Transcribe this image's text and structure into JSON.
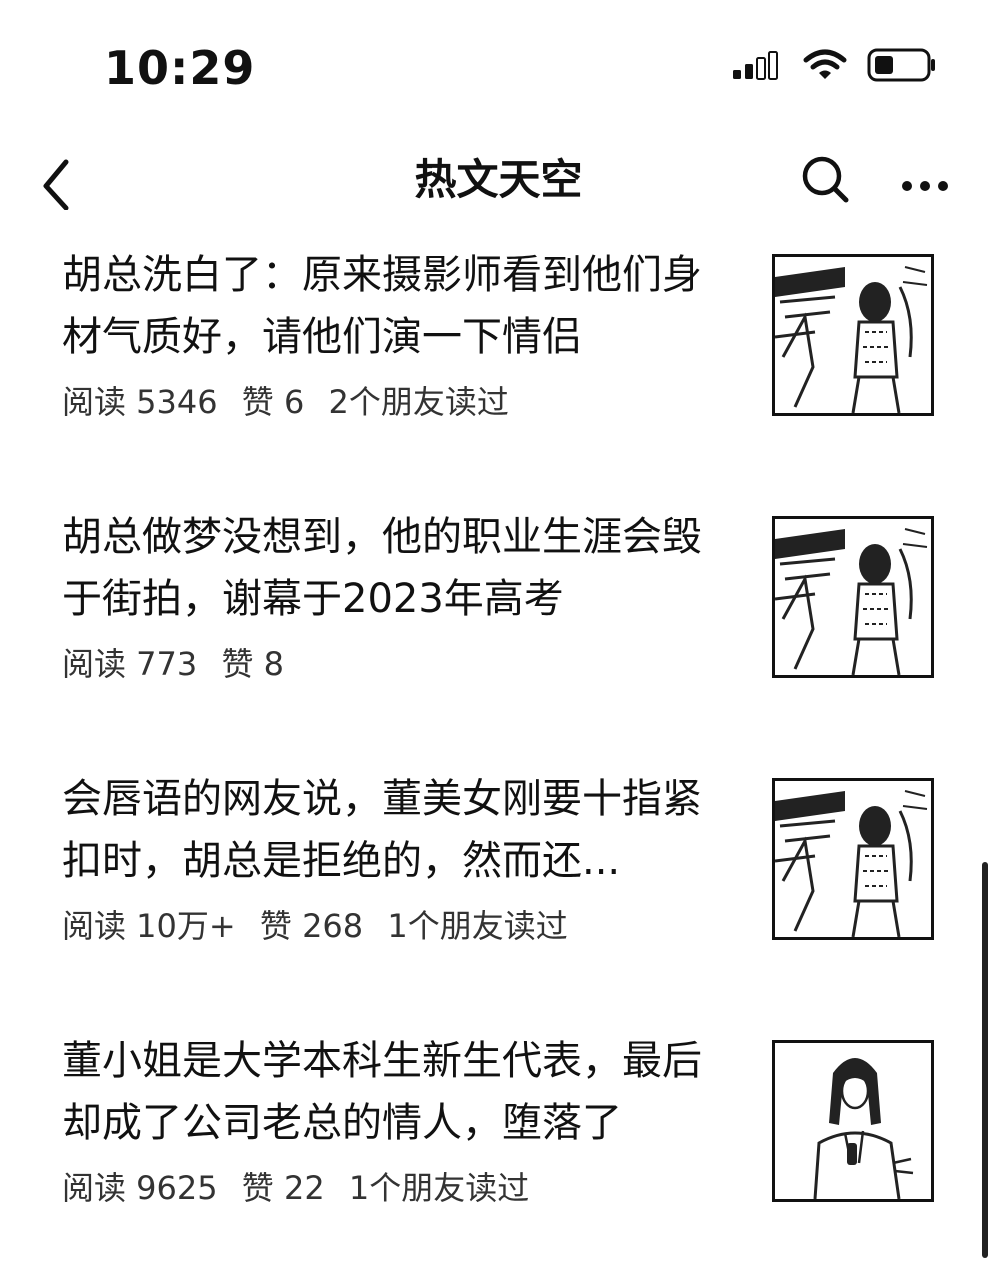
{
  "status_bar": {
    "time": "10:29",
    "icons": [
      "signal-icon",
      "wifi-icon",
      "battery-icon"
    ]
  },
  "nav": {
    "title": "热文天空",
    "icons": [
      "back-icon",
      "search-icon",
      "more-icon"
    ]
  },
  "articles": [
    {
      "title": "胡总洗白了：原来摄影师看到他们身材气质好，请他们演一下情侣",
      "reads": "阅读 5346",
      "likes": "赞 6",
      "friends": "2个朋友读过",
      "thumb_icon": "street-photo-thumbnail"
    },
    {
      "title": "胡总做梦没想到，他的职业生涯会毁于街拍，谢幕于2023年高考",
      "reads": "阅读 773",
      "likes": "赞 8",
      "friends": "",
      "thumb_icon": "street-photo-thumbnail"
    },
    {
      "title": "会唇语的网友说，董美女刚要十指紧扣时，胡总是拒绝的，然而还...",
      "reads": "阅读 10万+",
      "likes": "赞 268",
      "friends": "1个朋友读过",
      "thumb_icon": "street-photo-thumbnail"
    },
    {
      "title": "董小姐是大学本科生新生代表，最后却成了公司老总的情人，堕落了",
      "reads": "阅读 9625",
      "likes": "赞 22",
      "friends": "1个朋友读过",
      "thumb_icon": "speaker-portrait-thumbnail"
    }
  ]
}
